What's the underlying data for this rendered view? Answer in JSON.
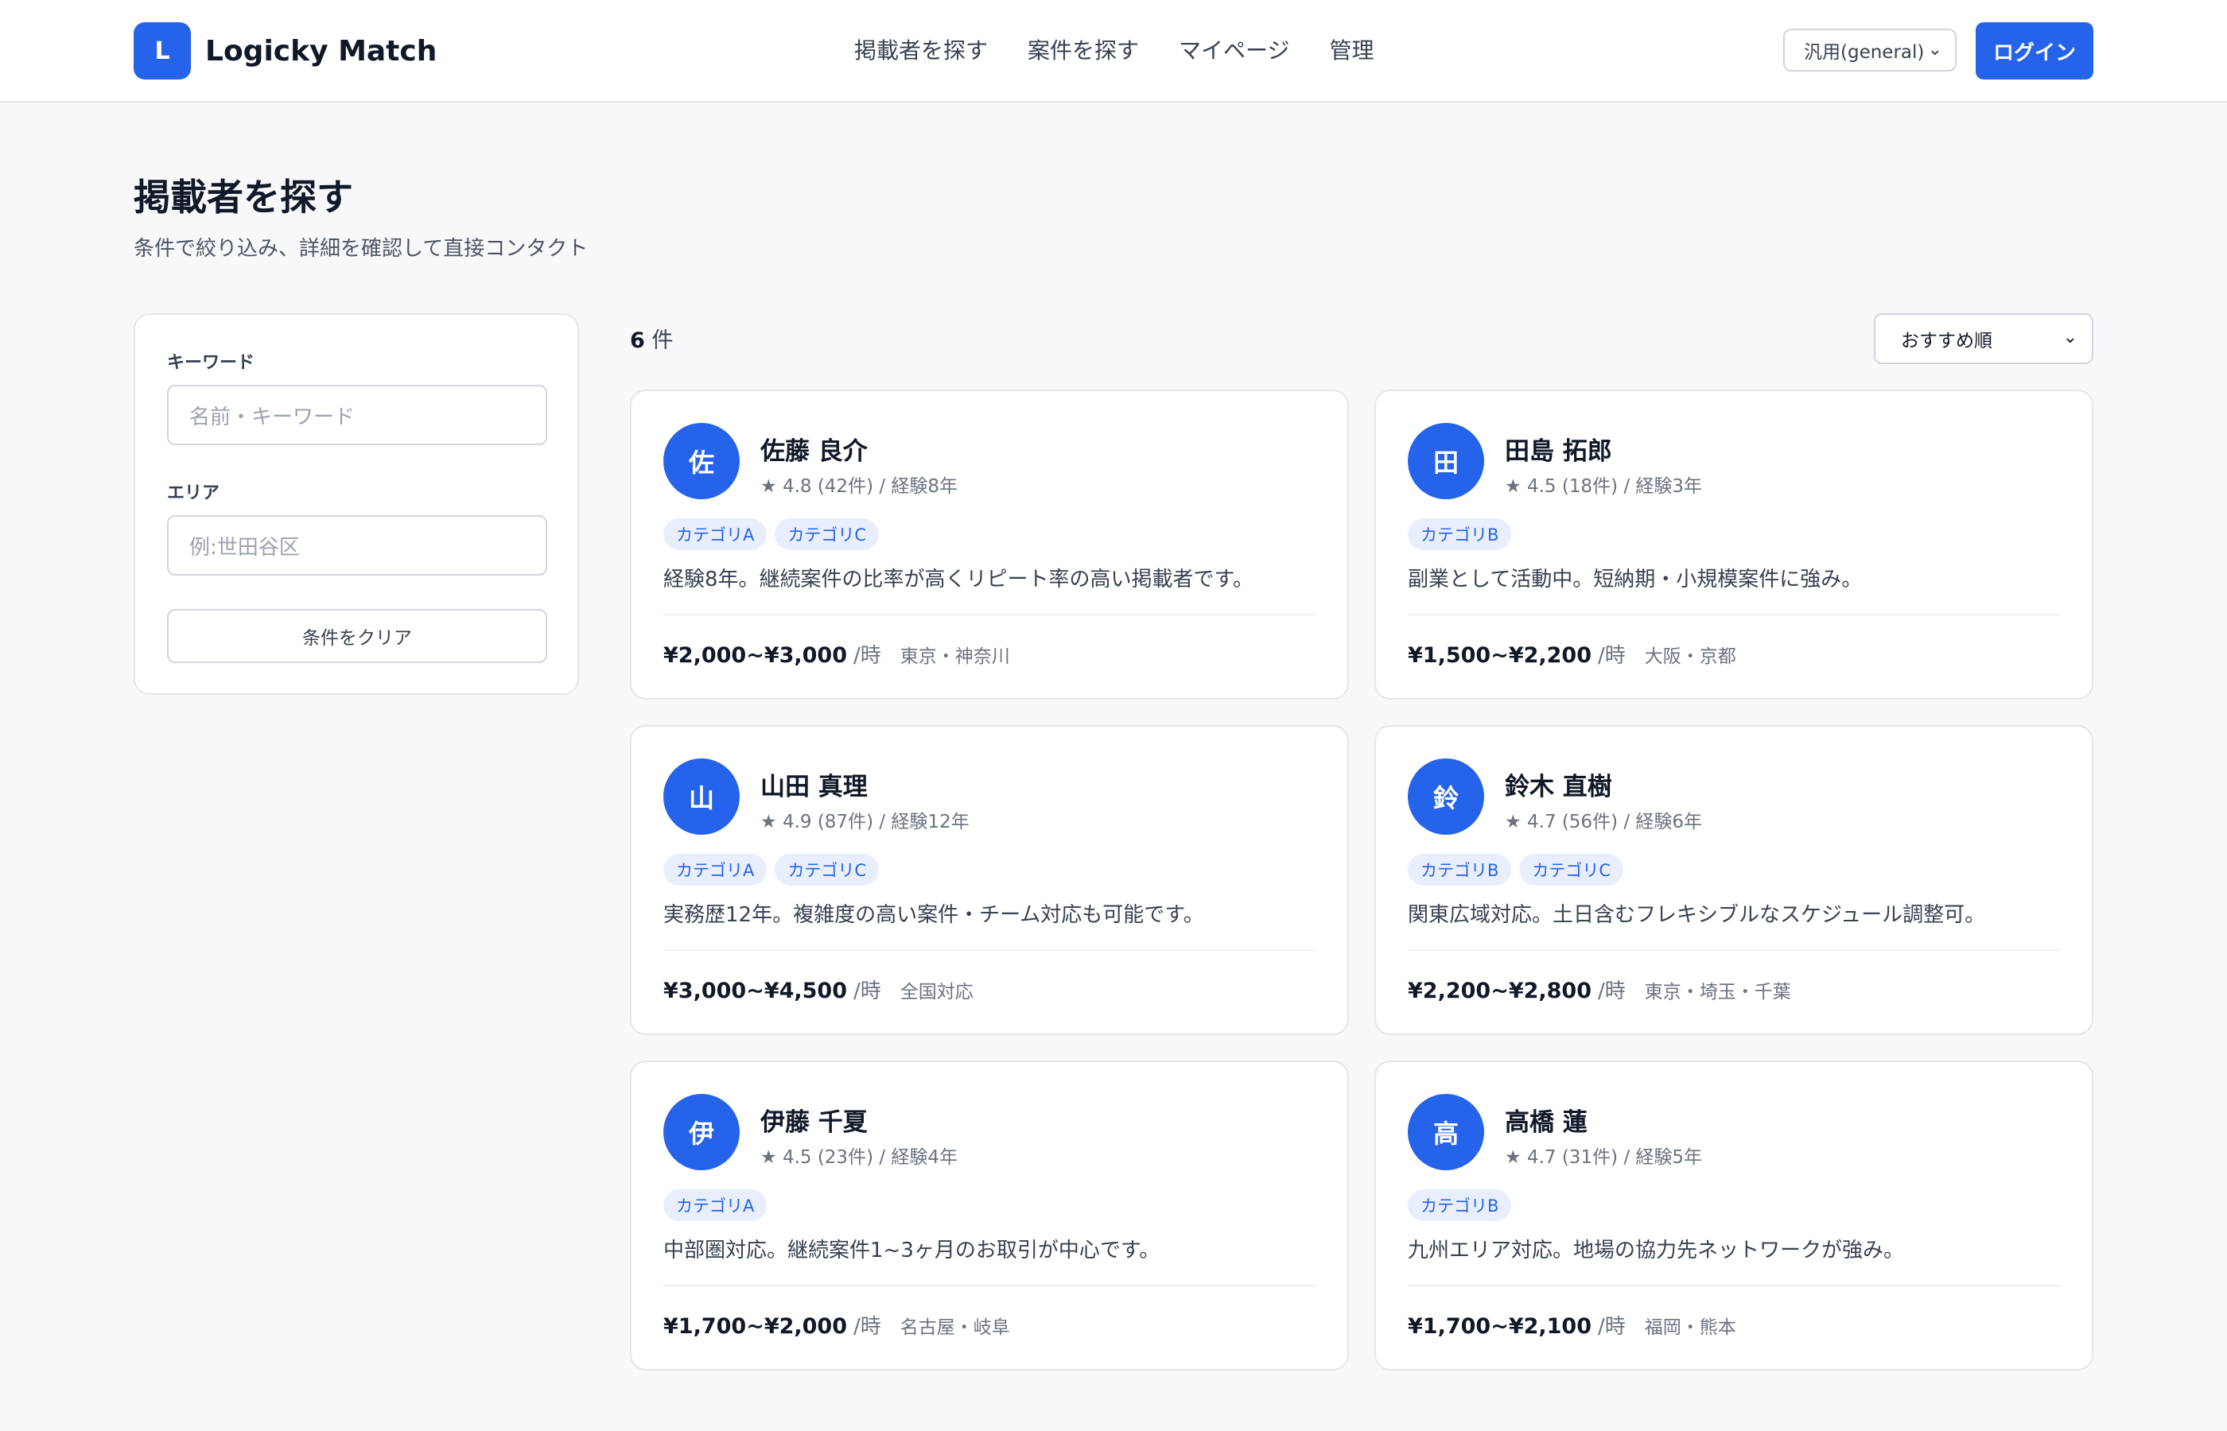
{
  "header": {
    "logo_letter": "L",
    "app_name": "Logicky Match",
    "nav": [
      "掲載者を探す",
      "案件を探す",
      "マイページ",
      "管理"
    ],
    "mode_select": "汎用(general)",
    "login_label": "ログイン"
  },
  "page": {
    "title": "掲載者を探す",
    "subtitle": "条件で絞り込み、詳細を確認して直接コンタクト"
  },
  "filter": {
    "keyword_label": "キーワード",
    "keyword_placeholder": "名前・キーワード",
    "area_label": "エリア",
    "area_placeholder": "例:世田谷区",
    "clear_label": "条件をクリア"
  },
  "results": {
    "count": "6",
    "count_unit": "件",
    "sort_selected": "おすすめ順"
  },
  "cards": [
    {
      "avatar": "佐",
      "name": "佐藤 良介",
      "rating": "4.8",
      "reviews": "(42件)",
      "experience": "経験8年",
      "tags": [
        "カテゴリA",
        "カテゴリC"
      ],
      "description": "経験8年。継続案件の比率が高くリピート率の高い掲載者です。",
      "price": "¥2,000~¥3,000",
      "unit": "/時",
      "area": "東京・神奈川"
    },
    {
      "avatar": "田",
      "name": "田島 拓郎",
      "rating": "4.5",
      "reviews": "(18件)",
      "experience": "経験3年",
      "tags": [
        "カテゴリB"
      ],
      "description": "副業として活動中。短納期・小規模案件に強み。",
      "price": "¥1,500~¥2,200",
      "unit": "/時",
      "area": "大阪・京都"
    },
    {
      "avatar": "山",
      "name": "山田 真理",
      "rating": "4.9",
      "reviews": "(87件)",
      "experience": "経験12年",
      "tags": [
        "カテゴリA",
        "カテゴリC"
      ],
      "description": "実務歴12年。複雑度の高い案件・チーム対応も可能です。",
      "price": "¥3,000~¥4,500",
      "unit": "/時",
      "area": "全国対応"
    },
    {
      "avatar": "鈴",
      "name": "鈴木 直樹",
      "rating": "4.7",
      "reviews": "(56件)",
      "experience": "経験6年",
      "tags": [
        "カテゴリB",
        "カテゴリC"
      ],
      "description": "関東広域対応。土日含むフレキシブルなスケジュール調整可。",
      "price": "¥2,200~¥2,800",
      "unit": "/時",
      "area": "東京・埼玉・千葉"
    },
    {
      "avatar": "伊",
      "name": "伊藤 千夏",
      "rating": "4.5",
      "reviews": "(23件)",
      "experience": "経験4年",
      "tags": [
        "カテゴリA"
      ],
      "description": "中部圏対応。継続案件1~3ヶ月のお取引が中心です。",
      "price": "¥1,700~¥2,000",
      "unit": "/時",
      "area": "名古屋・岐阜"
    },
    {
      "avatar": "高",
      "name": "高橋 蓮",
      "rating": "4.7",
      "reviews": "(31件)",
      "experience": "経験5年",
      "tags": [
        "カテゴリB"
      ],
      "description": "九州エリア対応。地場の協力先ネットワークが強み。",
      "price": "¥1,700~¥2,100",
      "unit": "/時",
      "area": "福岡・熊本"
    }
  ],
  "icons": {
    "rating": "star-icon",
    "select": "chevron-down-icon"
  },
  "colors": {
    "accent": "#2563eb",
    "tag_bg": "#e8eefb"
  }
}
